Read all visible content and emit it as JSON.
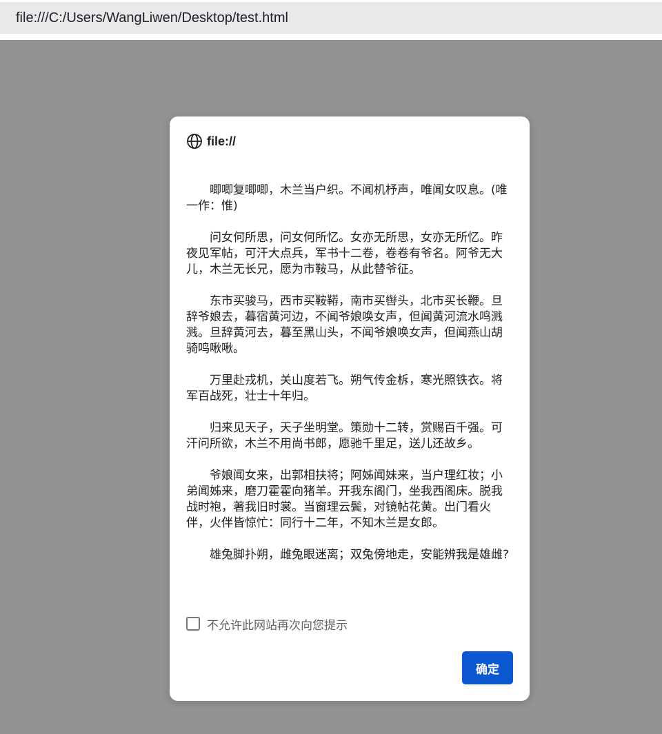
{
  "browser": {
    "address_bar": {
      "url": "file:///C:/Users/WangLiwen/Desktop/test.html",
      "site_info_icon": "site-info-icon"
    }
  },
  "dialog": {
    "origin": "file://",
    "origin_icon": "globe-icon",
    "message_paragraphs": [
      "唧唧复唧唧，木兰当户织。不闻机杼声，唯闻女叹息。(唯 一作：惟)",
      "问女何所思，问女何所忆。女亦无所思，女亦无所忆。昨夜见军帖，可汗大点兵，军书十二卷，卷卷有爷名。阿爷无大儿，木兰无长兄，愿为市鞍马，从此替爷征。",
      "东市买骏马，西市买鞍鞯，南市买辔头，北市买长鞭。旦辞爷娘去，暮宿黄河边，不闻爷娘唤女声，但闻黄河流水鸣溅溅。旦辞黄河去，暮至黑山头，不闻爷娘唤女声，但闻燕山胡骑鸣啾啾。",
      "万里赴戎机，关山度若飞。朔气传金柝，寒光照铁衣。将军百战死，壮士十年归。",
      "归来见天子，天子坐明堂。策勋十二转，赏赐百千强。可汗问所欲，木兰不用尚书郎，愿驰千里足，送儿还故乡。",
      "爷娘闻女来，出郭相扶将；阿姊闻妹来，当户理红妆；小弟闻姊来，磨刀霍霍向猪羊。开我东阁门，坐我西阁床。脱我战时袍，著我旧时裳。当窗理云鬓，对镜帖花黄。出门看火伴，火伴皆惊忙：同行十二年，不知木兰是女郎。",
      "雄兔脚扑朔，雌兔眼迷离；双兔傍地走，安能辨我是雄雌?"
    ],
    "suppress_checkbox": {
      "label": "不允许此网站再次向您提示",
      "checked": false
    },
    "ok_button_label": "确定"
  },
  "colors": {
    "backdrop": "#939393",
    "dialog_background": "#ffffff",
    "button_background": "#0b57d0",
    "button_text": "#ffffff",
    "address_pill": "#e9e9ec"
  }
}
